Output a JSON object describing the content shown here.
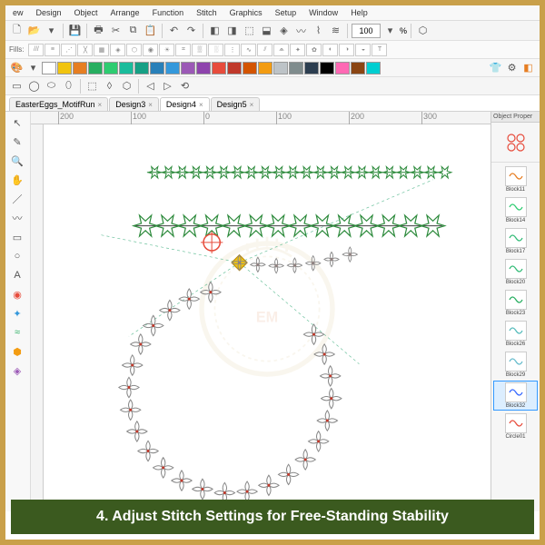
{
  "menus": [
    "ew",
    "Design",
    "Object",
    "Arrange",
    "Function",
    "Stitch",
    "Graphics",
    "Setup",
    "Window",
    "Help"
  ],
  "toolbar": {
    "zoom_value": "100",
    "zoom_suffix": "%"
  },
  "fills_label": "Fills:",
  "tabs": [
    {
      "label": "EasterEggs_MotifRun",
      "active": false
    },
    {
      "label": "Design3",
      "active": false
    },
    {
      "label": "Design4",
      "active": true
    },
    {
      "label": "Design5",
      "active": false
    }
  ],
  "ruler_ticks": [
    "200",
    "100",
    "0",
    "100",
    "200",
    "300"
  ],
  "panel_title": "Object Proper",
  "blocks": [
    {
      "label": "Block11",
      "color": "#e67e22"
    },
    {
      "label": "Block14",
      "color": "#2ecc71"
    },
    {
      "label": "Block17",
      "color": "#3b7"
    },
    {
      "label": "Block20",
      "color": "#3b7"
    },
    {
      "label": "Block23",
      "color": "#27ae60"
    },
    {
      "label": "Block26",
      "color": "#5bb"
    },
    {
      "label": "Block29",
      "color": "#6bc"
    },
    {
      "label": "Block32",
      "color": "#36f",
      "selected": true
    },
    {
      "label": "Circle01",
      "color": "#e74c3c"
    }
  ],
  "colors_row": [
    "#ffffff",
    "#f1c40f",
    "#e67e22",
    "#27ae60",
    "#2ecc71",
    "#1abc9c",
    "#16a085",
    "#2980b9",
    "#3498db",
    "#9b59b6",
    "#8e44ad",
    "#e74c3c",
    "#c0392b",
    "#d35400",
    "#f39c12",
    "#bdc3c7",
    "#7f8c8d",
    "#2c3e50",
    "#000000",
    "#ff69b4",
    "#8b4513",
    "#00ced1"
  ],
  "caption": "4. Adjust Stitch Settings for Free-Standing Stability"
}
